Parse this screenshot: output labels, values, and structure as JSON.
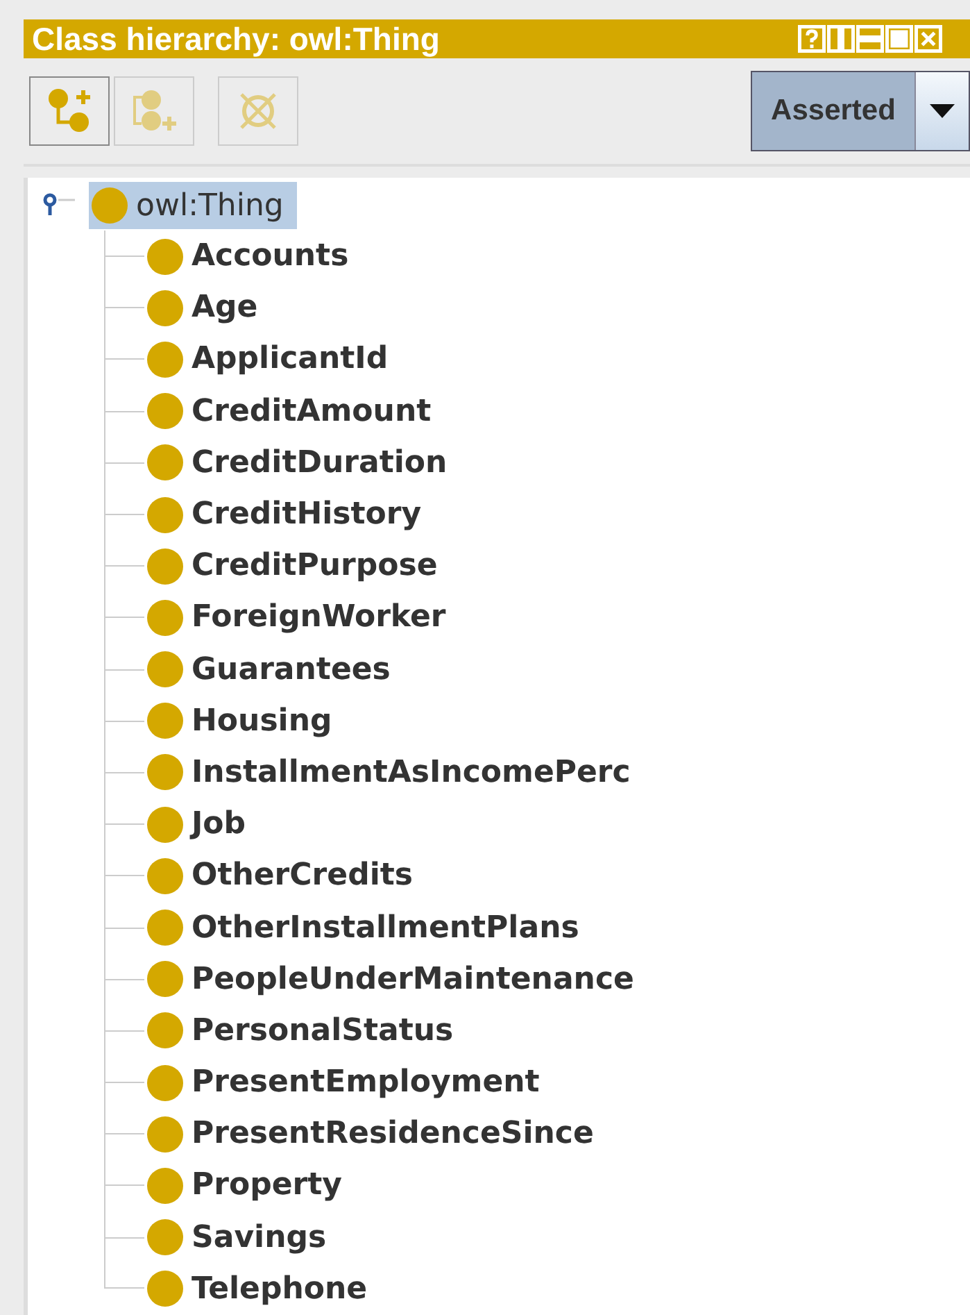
{
  "panel": {
    "title": "Class hierarchy: owl:Thing"
  },
  "toolbar": [
    {
      "kind": "add-subclass",
      "disabled": false
    },
    {
      "kind": "add-sibling",
      "disabled": true
    },
    {
      "kind": "delete",
      "disabled": true
    }
  ],
  "view_selector": {
    "value": "Asserted"
  },
  "tree": [
    {
      "label": "owl:Thing",
      "selected": true,
      "expanded": true,
      "children": [
        {
          "label": "Accounts",
          "selected": false
        },
        {
          "label": "Age",
          "selected": false
        },
        {
          "label": "ApplicantId",
          "selected": false
        },
        {
          "label": "CreditAmount",
          "selected": false
        },
        {
          "label": "CreditDuration",
          "selected": false
        },
        {
          "label": "CreditHistory",
          "selected": false
        },
        {
          "label": "CreditPurpose",
          "selected": false
        },
        {
          "label": "ForeignWorker",
          "selected": false
        },
        {
          "label": "Guarantees",
          "selected": false
        },
        {
          "label": "Housing",
          "selected": false
        },
        {
          "label": "InstallmentAsIncomePerc",
          "selected": false
        },
        {
          "label": "Job",
          "selected": false
        },
        {
          "label": "OtherCredits",
          "selected": false
        },
        {
          "label": "OtherInstallmentPlans",
          "selected": false
        },
        {
          "label": "PeopleUnderMaintenance",
          "selected": false
        },
        {
          "label": "PersonalStatus",
          "selected": false
        },
        {
          "label": "PresentEmployment",
          "selected": false
        },
        {
          "label": "PresentResidenceSince",
          "selected": false
        },
        {
          "label": "Property",
          "selected": false
        },
        {
          "label": "Savings",
          "selected": false
        },
        {
          "label": "Telephone",
          "selected": false
        }
      ]
    }
  ]
}
